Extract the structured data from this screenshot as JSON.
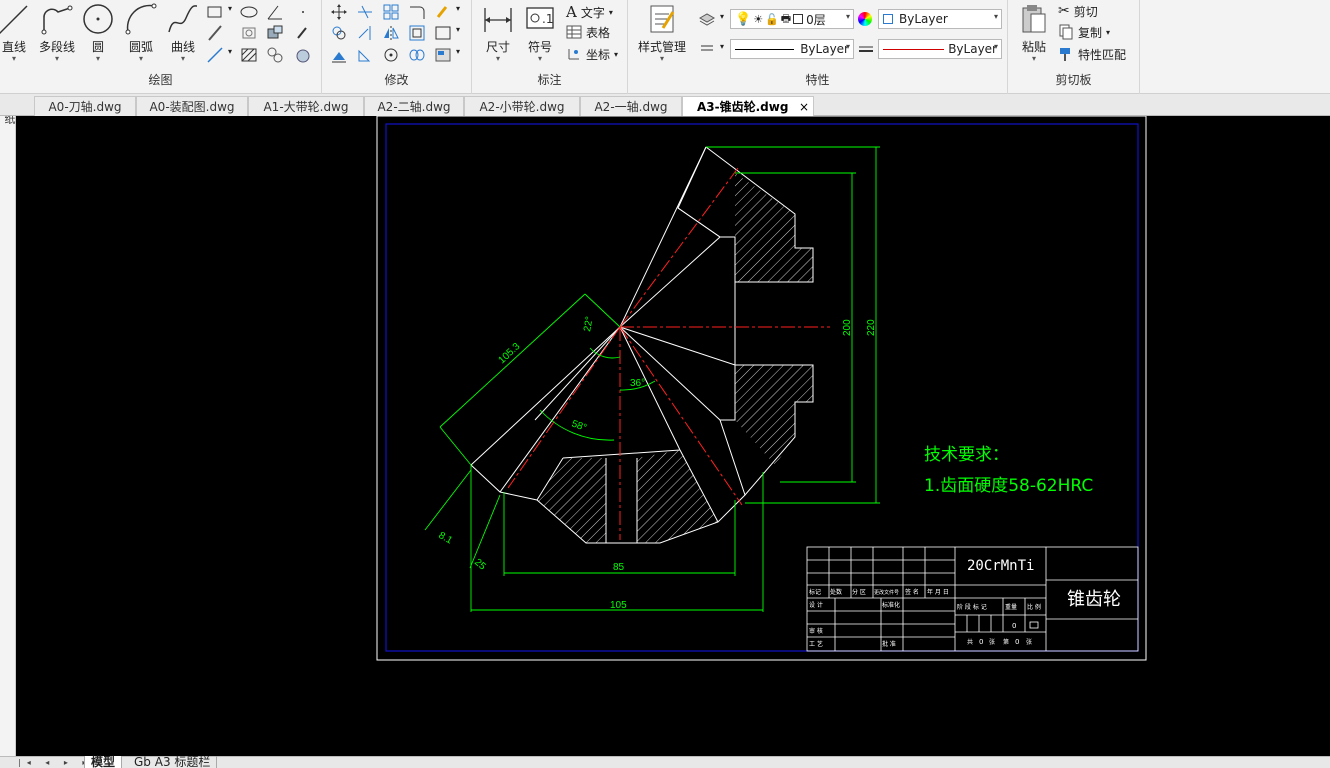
{
  "ribbon": {
    "draw": {
      "title": "绘图",
      "tools": [
        {
          "label": "直线"
        },
        {
          "label": "多段线"
        },
        {
          "label": "圆"
        },
        {
          "label": "圆弧"
        },
        {
          "label": "曲线"
        }
      ]
    },
    "modify": {
      "title": "修改"
    },
    "annotation": {
      "title": "标注",
      "dimension": "尺寸",
      "symbol": "符号",
      "text": "文字",
      "table": "表格",
      "coordinate": "坐标"
    },
    "properties": {
      "title": "特性",
      "style_manager": "样式管理",
      "layer": "0层",
      "color": "ByLayer",
      "linetype": "ByLayer",
      "lineweight": "ByLayer"
    },
    "clipboard": {
      "title": "剪切板",
      "paste": "粘贴",
      "cut": "剪切",
      "copy": "复制",
      "match": "特性匹配"
    }
  },
  "left_strip": {
    "label": "图纸"
  },
  "tabs": [
    {
      "label": "A0-刀轴.dwg"
    },
    {
      "label": "A0-装配图.dwg"
    },
    {
      "label": "A1-大带轮.dwg"
    },
    {
      "label": "A2-二轴.dwg"
    },
    {
      "label": "A2-小带轮.dwg"
    },
    {
      "label": "A2-一轴.dwg"
    },
    {
      "label": "A3-锥齿轮.dwg",
      "active": true,
      "close": "×"
    }
  ],
  "drawing": {
    "dims": {
      "d200": "200",
      "d220": "220",
      "d105_3": "105.3",
      "a22": "22°",
      "a36": "36°",
      "a58": "58°",
      "d8_1": "8.1",
      "d25": "25",
      "d85": "85",
      "d105": "105"
    },
    "tech_title": "技术要求：",
    "tech_req": "1.齿面硬度58-62HRC",
    "titleblock": {
      "material": "20CrMnTi",
      "part_name": "锥齿轮",
      "row_labels": [
        "标记",
        "处数",
        "分 区",
        "更改文件号",
        "签 名",
        "年 月 日"
      ],
      "design": "设 计",
      "standardize": "标准化",
      "stage_mark": "阶 段 标 记",
      "weight": "重量",
      "scale": "比 例",
      "review": "审 核",
      "process": "工 艺",
      "approve": "批 准",
      "sheets": "共",
      "sheet_unit": "张",
      "sheet_no": "第",
      "zero": "0"
    }
  },
  "bottom_tabs": [
    {
      "label": "模型",
      "active": true
    },
    {
      "label": "Gb A3 标题栏"
    }
  ],
  "colors": {
    "canvas": "#000000",
    "frame_blue": "#1010c8",
    "dim_green": "#00ff00",
    "center_red": "#ff2020",
    "line_white": "#ffffff"
  }
}
